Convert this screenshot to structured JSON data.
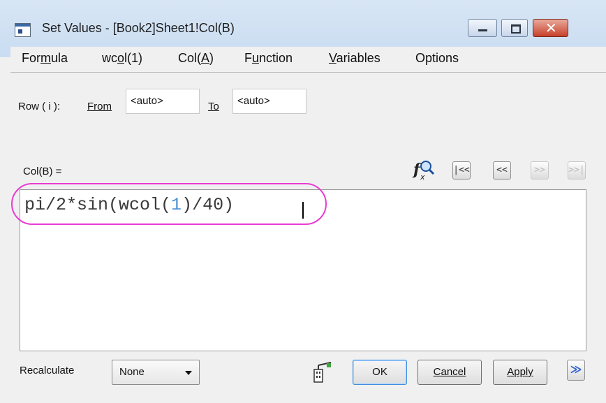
{
  "window": {
    "title": "Set Values - [Book2]Sheet1!Col(B)"
  },
  "menu": [
    {
      "pre": "For",
      "u": "m",
      "post": "ula"
    },
    {
      "pre": "wc",
      "u": "o",
      "post": "l(1)"
    },
    {
      "pre": "Col(",
      "u": "A",
      "post": ")"
    },
    {
      "pre": "F",
      "u": "u",
      "post": "nction"
    },
    {
      "pre": "",
      "u": "V",
      "post": "ariables"
    },
    {
      "pre": "Options",
      "u": "",
      "post": ""
    }
  ],
  "row": {
    "label": "Row ( i ):",
    "from_label": "From",
    "from_value": "<auto>",
    "to_label": "To",
    "to_value": "<auto>"
  },
  "formula": {
    "col_label": "Col(B) =",
    "parts": [
      "pi/2*sin(wcol(",
      "1",
      ")/40)"
    ]
  },
  "toolbar": {
    "first": "|<<",
    "prev": "<<",
    "next": ">>",
    "last": ">>|"
  },
  "bottom": {
    "recalculate_label": "Recalculate",
    "recalculate_value": "None",
    "ok": "OK",
    "cancel": "Cancel",
    "apply": "Apply",
    "expand": "≫"
  },
  "colors": {
    "highlight": "#e83cd3",
    "number": "#4a8fd6"
  }
}
